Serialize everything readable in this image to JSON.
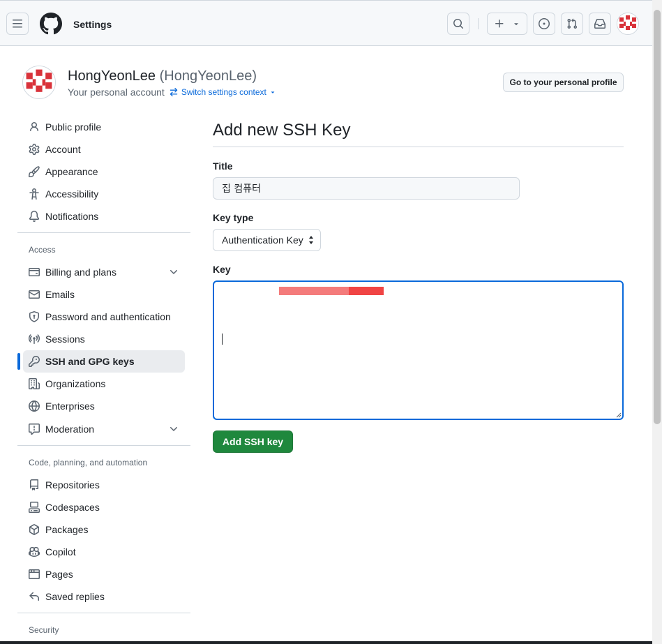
{
  "header": {
    "context_title": "Settings",
    "icons": {
      "menu": "three-bars-icon",
      "logo": "github-mark-icon",
      "search": "search-icon",
      "create": "plus-icon",
      "issues": "issue-opened-icon",
      "pulls": "git-pull-request-icon",
      "inbox": "inbox-icon"
    }
  },
  "profile": {
    "display_name": "HongYeonLee",
    "login": "(HongYeonLee)",
    "subtitle": "Your personal account",
    "switch_context": "Switch settings context",
    "go_to_profile": "Go to your personal profile"
  },
  "sidebar": {
    "top_items": [
      {
        "label": "Public profile",
        "icon": "person-icon"
      },
      {
        "label": "Account",
        "icon": "gear-icon"
      },
      {
        "label": "Appearance",
        "icon": "paintbrush-icon"
      },
      {
        "label": "Accessibility",
        "icon": "accessibility-icon"
      },
      {
        "label": "Notifications",
        "icon": "bell-icon"
      }
    ],
    "access_heading": "Access",
    "access_items": [
      {
        "label": "Billing and plans",
        "icon": "credit-card-icon"
      },
      {
        "label": "Emails",
        "icon": "mail-icon"
      },
      {
        "label": "Password and authentication",
        "icon": "shield-lock-icon"
      },
      {
        "label": "Sessions",
        "icon": "broadcast-icon"
      },
      {
        "label": "SSH and GPG keys",
        "icon": "key-icon",
        "active": true
      },
      {
        "label": "Organizations",
        "icon": "organization-icon"
      },
      {
        "label": "Enterprises",
        "icon": "globe-icon"
      },
      {
        "label": "Moderation",
        "icon": "report-icon"
      }
    ],
    "code_heading": "Code, planning, and automation",
    "code_items": [
      {
        "label": "Repositories",
        "icon": "repo-icon"
      },
      {
        "label": "Codespaces",
        "icon": "codespaces-icon"
      },
      {
        "label": "Packages",
        "icon": "package-icon"
      },
      {
        "label": "Copilot",
        "icon": "copilot-icon"
      },
      {
        "label": "Pages",
        "icon": "browser-icon"
      },
      {
        "label": "Saved replies",
        "icon": "reply-icon"
      }
    ],
    "security_heading": "Security"
  },
  "main": {
    "title": "Add new SSH Key",
    "title_label": "Title",
    "title_value": "집 컴퓨터",
    "key_type_label": "Key type",
    "key_type_value": "Authentication Key",
    "key_label": "Key",
    "submit_label": "Add SSH key"
  },
  "colors": {
    "accent": "#0969da",
    "primary_button": "#1f883d",
    "redaction_light": "#f47b7b",
    "redaction_dark": "#f04444"
  }
}
